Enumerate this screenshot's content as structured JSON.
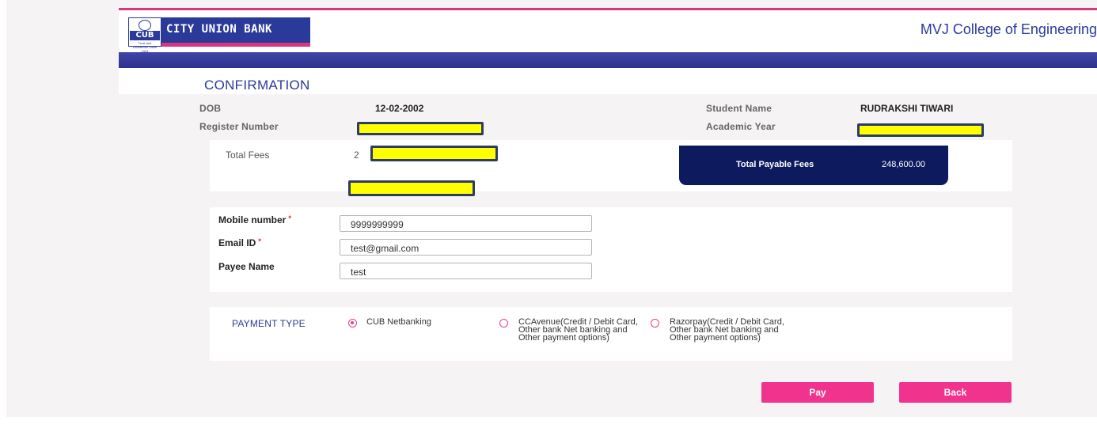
{
  "header": {
    "bank_name": "CITY UNION BANK",
    "logo_abbrev": "CUB",
    "logo_tagline": "Trust and Excellence Since 1904",
    "college_name": "MVJ College of Engineering",
    "page_title": "CONFIRMATION"
  },
  "student_info": {
    "dob_label": "DOB",
    "dob_value": "12-02-2002",
    "register_label": "Register Number",
    "student_name_label": "Student Name",
    "student_name_value": "RUDRAKSHI TIWARI",
    "academic_year_label": "Academic Year"
  },
  "fees": {
    "total_fees_label": "Total Fees",
    "total_fees_prefix": "2",
    "payable_label": "Total Payable Fees",
    "payable_value": "248,600.00"
  },
  "form": {
    "mobile_label": "Mobile number",
    "mobile_value": "9999999999",
    "email_label": "Email ID",
    "email_value": "test@gmail.com",
    "payee_label": "Payee Name",
    "payee_value": "test",
    "required_mark": "*"
  },
  "payment": {
    "label": "PAYMENT TYPE",
    "options": [
      {
        "text": "CUB Netbanking",
        "selected": true
      },
      {
        "text": "CCAvenue(Credit / Debit Card, Other bank Net banking and Other payment options)",
        "selected": false
      },
      {
        "text": "Razorpay(Credit / Debit Card, Other bank Net banking and Other payment options)",
        "selected": false
      }
    ]
  },
  "buttons": {
    "pay": "Pay",
    "back": "Back"
  },
  "colors": {
    "brand_blue": "#2a3a9a",
    "accent_pink": "#f0338c",
    "payable_bg": "#0e1a5e",
    "redaction": "#ffff00"
  }
}
